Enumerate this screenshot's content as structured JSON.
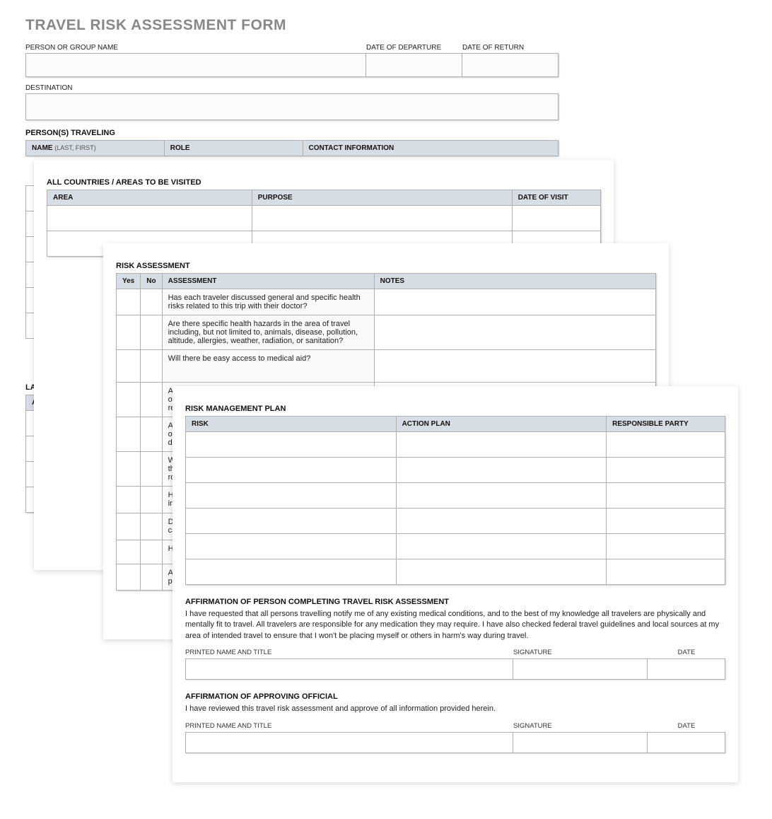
{
  "title": "TRAVEL RISK ASSESSMENT FORM",
  "top_fields": {
    "person_group": "PERSON OR GROUP NAME",
    "departure": "DATE OF DEPARTURE",
    "return": "DATE OF RETURN",
    "destination": "DESTINATION"
  },
  "persons": {
    "heading": "PERSON(S) TRAVELING",
    "name_hdr": "NAME",
    "name_sub": "(LAST, FIRST)",
    "role_hdr": "ROLE",
    "contact_hdr": "CONTACT INFORMATION"
  },
  "countries": {
    "heading": "ALL COUNTRIES / AREAS TO BE VISITED",
    "area_hdr": "AREA",
    "purpose_hdr": "PURPOSE",
    "date_hdr": "DATE OF VISIT"
  },
  "guidelines": {
    "heading": "LATEST GUIDELINE",
    "area_hdr": "AREA"
  },
  "assessment": {
    "heading": "RISK ASSESSMENT",
    "yes_hdr": "Yes",
    "no_hdr": "No",
    "assessment_hdr": "ASSESSMENT",
    "notes_hdr": "NOTES",
    "q1": "Has each traveler discussed general and specific health risks related to this trip with their doctor?",
    "q2": "Are there specific health hazards in the area of travel including, but not limited to, animals, disease, pollution, altitude, allergies, weather, radiation, or sanitation?",
    "q3": "Will there be easy access to medical aid?",
    "q4": "Are t\nof tra\nreligi",
    "q5": "Are t\nof tra\ndrive",
    "q6": "Will t\nthe t\nroan",
    "q7": "Has e\ninfor",
    "q8": "Do tr\ncase",
    "q9": "Have",
    "q10": "Are o\nplan"
  },
  "plan": {
    "heading": "RISK MANAGEMENT PLAN",
    "risk_hdr": "RISK",
    "action_hdr": "ACTION PLAN",
    "party_hdr": "RESPONSIBLE PARTY"
  },
  "affirm1": {
    "heading": "AFFIRMATION OF PERSON COMPLETING TRAVEL RISK ASSESSMENT",
    "text": "I have requested that all persons travelling notify me of any existing medical conditions, and to the best of my knowledge all travelers are physically and mentally fit to travel. All travelers are responsible for any medication they may require. I have also checked federal travel guidelines and local sources at my area of intended travel to ensure that I won't be placing myself or others in harm's way during travel."
  },
  "affirm2": {
    "heading": "AFFIRMATION OF APPROVING OFFICIAL",
    "text": "I have reviewed this travel risk assessment and approve of all information provided herein."
  },
  "sig": {
    "name": "PRINTED NAME AND TITLE",
    "signature": "SIGNATURE",
    "date": "DATE"
  }
}
